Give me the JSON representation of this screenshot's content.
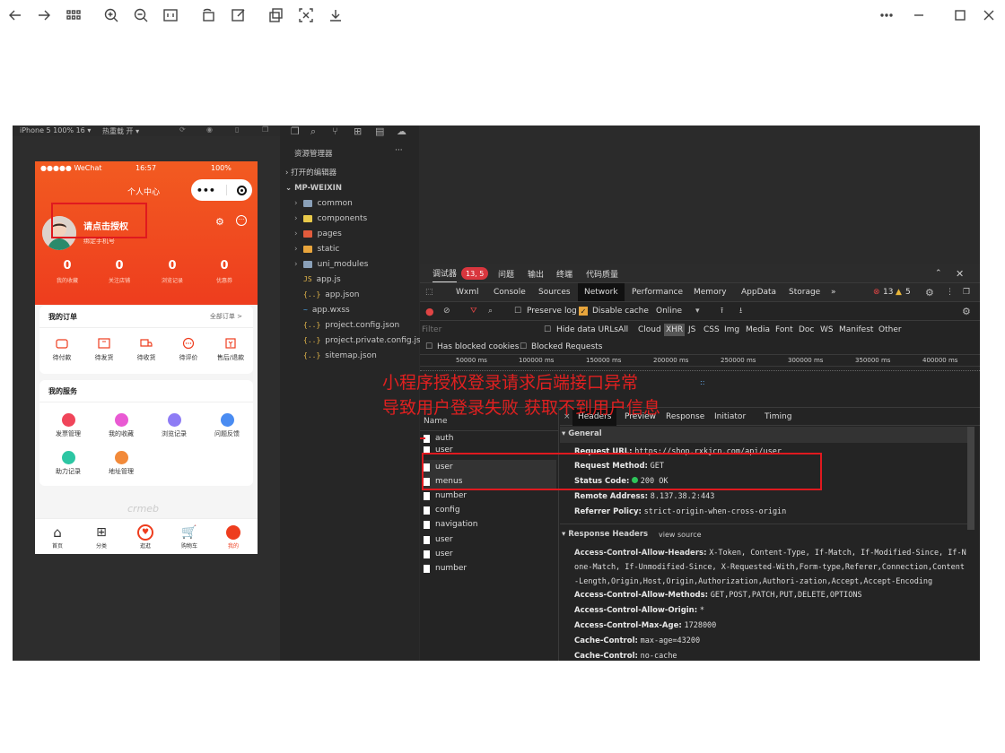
{
  "viewer": {
    "toolbar_icons": [
      "back-icon",
      "forward-icon",
      "grid-icon",
      "zoom-in-icon",
      "zoom-out-icon",
      "actual-size-icon",
      "rotate-icon",
      "edit-icon",
      "crop-icon",
      "ocr-icon",
      "download-icon"
    ],
    "window_controls": [
      "more-icon",
      "minimize-icon",
      "maximize-icon",
      "close-icon"
    ]
  },
  "simulator": {
    "device": "iPhone 5 100% 16 ▾",
    "hot_reload": "热重载 开 ▾"
  },
  "phone": {
    "carrier": "●●●●● WeChat",
    "time": "16:57",
    "battery": "100%",
    "capsule_dots": "•••",
    "page_title": "个人中心",
    "login_prompt": "请点击授权",
    "bind_phone": "绑定手机号",
    "stats": [
      {
        "num": "0",
        "label": "我的收藏"
      },
      {
        "num": "0",
        "label": "关注店铺"
      },
      {
        "num": "0",
        "label": "浏览记录"
      },
      {
        "num": "0",
        "label": "优惠券"
      }
    ],
    "orders": {
      "title": "我的订单",
      "more": "全部订单 >",
      "items": [
        "待付款",
        "待发货",
        "待收货",
        "待评价",
        "售后/退款"
      ]
    },
    "services": {
      "title": "我的服务",
      "items": [
        "发票管理",
        "我的收藏",
        "浏览记录",
        "问题反馈",
        "助力记录",
        "地址管理"
      ]
    },
    "watermark": "crmeb",
    "tabbar": [
      "首页",
      "分类",
      "逛逛",
      "购物车",
      "我的"
    ],
    "colors": {
      "brand": "#ee3d1e",
      "brand_light": "#f25b21"
    }
  },
  "explorer": {
    "title": "资源管理器",
    "more": "···",
    "open_editors": "› 打开的编辑器",
    "project": "⌄ MP-WEIXIN",
    "folders": [
      "common",
      "components",
      "pages",
      "static",
      "uni_modules"
    ],
    "files": [
      {
        "ico": "JS",
        "name": "app.js"
      },
      {
        "ico": "{..}",
        "name": "app.json"
      },
      {
        "ico": "~",
        "name": "app.wxss"
      },
      {
        "ico": "{..}",
        "name": "project.config.json"
      },
      {
        "ico": "{..}",
        "name": "project.private.config.js..."
      },
      {
        "ico": "{..}",
        "name": "sitemap.json"
      }
    ]
  },
  "devtools": {
    "top_tabs": [
      "调试器",
      "问题",
      "输出",
      "终端",
      "代码质量"
    ],
    "badge": "13, 5",
    "panels": [
      "Wxml",
      "Console",
      "Sources",
      "Network",
      "Performance",
      "Memory",
      "AppData",
      "Storage",
      "»"
    ],
    "errors": "13",
    "warnings": "5",
    "preserve_log": "Preserve log",
    "disable_cache": "Disable cache",
    "online": "Online",
    "filter_placeholder": "Filter",
    "hide_data_urls": "Hide data URLs",
    "filter_types": [
      "All",
      "Cloud",
      "XHR",
      "JS",
      "CSS",
      "Img",
      "Media",
      "Font",
      "Doc",
      "WS",
      "Manifest",
      "Other"
    ],
    "has_blocked_cookies": "Has blocked cookies",
    "blocked_requests": "Blocked Requests",
    "timeline_ticks": [
      "50000 ms",
      "100000 ms",
      "150000 ms",
      "200000 ms",
      "250000 ms",
      "300000 ms",
      "350000 ms",
      "400000 ms"
    ],
    "name_header": "Name",
    "requests": [
      "auth",
      "user",
      "user",
      "menus",
      "number",
      "config",
      "navigation",
      "user",
      "user",
      "number"
    ],
    "detail_tabs": [
      "×",
      "Headers",
      "Preview",
      "Response",
      "Initiator",
      "Timing"
    ],
    "general_title": "▾ General",
    "general": [
      {
        "k": "Request URL:",
        "v": "https://shop.rxkjcn.com/api/user"
      },
      {
        "k": "Request Method:",
        "v": "GET"
      },
      {
        "k": "Status Code:",
        "v": "200 OK"
      },
      {
        "k": "Remote Address:",
        "v": "8.137.38.2:443"
      },
      {
        "k": "Referrer Policy:",
        "v": "strict-origin-when-cross-origin"
      }
    ],
    "response_headers_title": "▾ Response Headers",
    "view_source": "view source",
    "response_headers": [
      {
        "k": "Access-Control-Allow-Headers:",
        "v": "X-Token, Content-Type, If-Match, If-Modified-Since, If-None-Match, If-Unmodified-Since, X-Requested-With,Form-type,Referer,Connection,Content-Length,Origin,Host,Origin,Authorization,Authori-zation,Accept,Accept-Encoding"
      },
      {
        "k": "Access-Control-Allow-Methods:",
        "v": "GET,POST,PATCH,PUT,DELETE,OPTIONS"
      },
      {
        "k": "Access-Control-Allow-Origin:",
        "v": "*"
      },
      {
        "k": "Access-Control-Max-Age:",
        "v": "1728000"
      },
      {
        "k": "Cache-Control:",
        "v": "max-age=43200"
      },
      {
        "k": "Cache-Control:",
        "v": "no-cache"
      }
    ]
  },
  "annotation": {
    "line1": "小程序授权登录请求后端接口异常",
    "line2": "导致用户登录失败 获取不到用户信息",
    "color": "#e02020"
  }
}
